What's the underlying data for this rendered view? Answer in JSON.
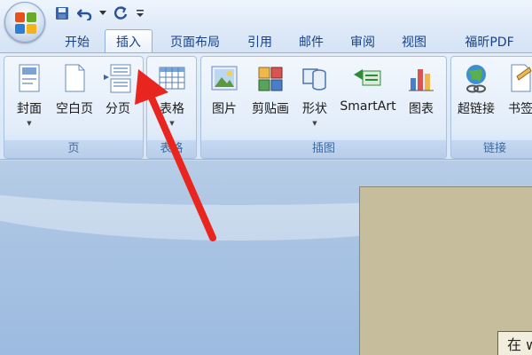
{
  "quick_access": {
    "save_icon": "save-icon",
    "undo_icon": "undo-icon",
    "redo_icon": "redo-icon",
    "customize_icon": "customize-quick-access-icon"
  },
  "tabs": [
    {
      "label": "开始"
    },
    {
      "label": "插入",
      "active": true
    },
    {
      "label": "页面布局"
    },
    {
      "label": "引用"
    },
    {
      "label": "邮件"
    },
    {
      "label": "审阅"
    },
    {
      "label": "视图"
    },
    {
      "label": "福昕PDF"
    }
  ],
  "ribbon": {
    "pages_group": {
      "label": "页",
      "cover": "封面",
      "blank_page": "空白页",
      "page_break": "分页"
    },
    "tables_group": {
      "label": "表格",
      "table": "表格"
    },
    "illustrations_group": {
      "label": "插图",
      "picture": "图片",
      "clipart": "剪贴画",
      "shapes": "形状",
      "smartart": "SmartArt",
      "chart": "图表"
    },
    "links_group": {
      "label": "链接",
      "hyperlink": "超链接",
      "bookmark": "书签"
    }
  },
  "document": {
    "text_snippet": "在 w"
  },
  "colors": {
    "arrow": "#e8261f",
    "tab_text": "#15428b",
    "page": "#c6bd9c"
  }
}
